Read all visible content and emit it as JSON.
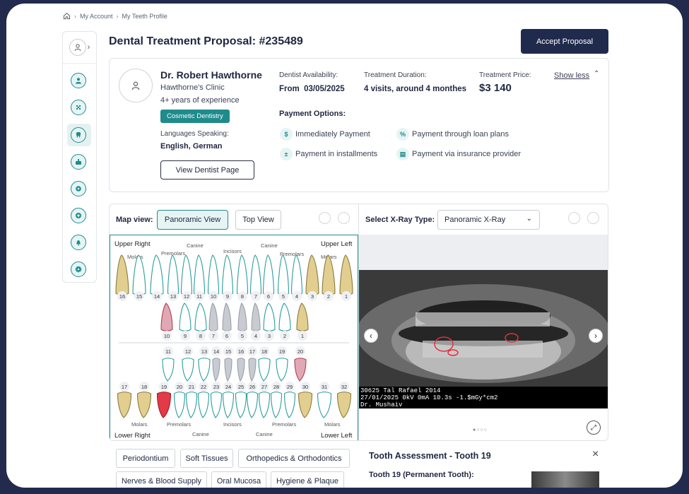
{
  "breadcrumb": {
    "items": [
      "My Account",
      "My Teeth Profile"
    ]
  },
  "page": {
    "title": "Dental Treatment Proposal: #235489",
    "accept_label": "Accept Proposal"
  },
  "dentist": {
    "name": "Dr. Robert Hawthorne",
    "clinic": "Hawthorne's Clinic",
    "experience": "4+ years of experience",
    "specialty": "Cosmetic Dentistry",
    "languages_label": "Languages Speaking:",
    "languages": "English, German",
    "view_page_label": "View Dentist Page"
  },
  "summary": {
    "availability_label": "Dentist Availability:",
    "availability": "From  03/05/2025",
    "duration_label": "Treatment Duration:",
    "duration": "4 visits, around 4 monthes",
    "price_label": "Treatment Price:",
    "price": "$3 140",
    "show_less": "Show less"
  },
  "payment": {
    "title": "Payment Options:",
    "options": [
      "Immediately Payment",
      "Payment through loan plans",
      "Payment in installments",
      "Payment via insurance provider"
    ]
  },
  "map": {
    "label": "Map view:",
    "tabs": [
      "Panoramic View",
      "Top View"
    ],
    "active_tab": 0,
    "quadrants": {
      "upper_right": "Upper Right",
      "upper_left": "Upper Left",
      "lower_right": "Lower Right",
      "lower_left": "Lower Left"
    },
    "groups": {
      "molars": "Molars",
      "premolars": "Premolars",
      "canine": "Canine",
      "incisors": "Incisors"
    },
    "upper_adult": [
      "16",
      "15",
      "14",
      "13",
      "12",
      "11",
      "10",
      "9",
      "8",
      "7",
      "6",
      "5",
      "4",
      "3",
      "2",
      "1"
    ],
    "upper_child": [
      "10",
      "9",
      "8",
      "7",
      "6",
      "5",
      "4",
      "3",
      "2",
      "1"
    ],
    "lower_child": [
      "11",
      "12",
      "13",
      "14",
      "15",
      "16",
      "17",
      "18",
      "19",
      "20"
    ],
    "lower_adult": [
      "17",
      "18",
      "19",
      "20",
      "21",
      "22",
      "23",
      "24",
      "25",
      "26",
      "27",
      "28",
      "29",
      "30",
      "31",
      "32"
    ],
    "colors": {
      "normal": "#2a9d9e",
      "treated": "#e0a8b4",
      "implant": "#c8ccd2",
      "selected": "#e23a46",
      "crown": "#e2cf90"
    }
  },
  "xray": {
    "label": "Select X-Ray Type:",
    "type": "Panoramic X-Ray",
    "caption": [
      "30625 Tal Rafael 2014",
      "27/01/2025 0kV 0mA 10.3s  -1.$mGy*cm2",
      "Dr. Mushaiv"
    ],
    "slide": 1,
    "slides": 4
  },
  "categories": [
    "Periodontium",
    "Soft Tissues",
    "Orthopedics & Orthodontics",
    "Nerves & Blood Supply",
    "Oral Mucosa",
    "Hygiene & Plaque"
  ],
  "assessment": {
    "title": "Tooth Assessment - Tooth 19",
    "subtitle": "Tooth 19 (Permanent Tooth):"
  }
}
